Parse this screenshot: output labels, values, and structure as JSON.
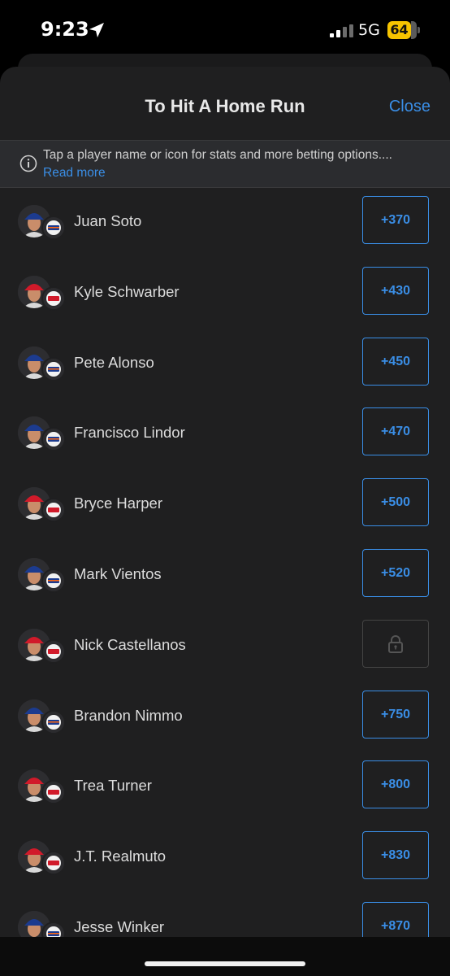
{
  "status_bar": {
    "time": "9:23",
    "network": "5G",
    "battery": "64",
    "icons": [
      "location-arrow-icon",
      "signal-icon",
      "battery-icon"
    ]
  },
  "sheet": {
    "title": "To Hit A Home Run",
    "close_label": "Close"
  },
  "banner": {
    "icon": "info-icon",
    "text": "Tap a player name or icon for stats and more betting options....",
    "link": "Read more"
  },
  "colors": {
    "accent": "#3a8ee6",
    "mets_blue": "#1c3b8f",
    "mets_orange": "#ff6a13",
    "phillies_red": "#d11a2a"
  },
  "players": [
    {
      "name": "Juan Soto",
      "odds": "+370",
      "team": "mets"
    },
    {
      "name": "Kyle Schwarber",
      "odds": "+430",
      "team": "phillies"
    },
    {
      "name": "Pete Alonso",
      "odds": "+450",
      "team": "mets"
    },
    {
      "name": "Francisco Lindor",
      "odds": "+470",
      "team": "mets"
    },
    {
      "name": "Bryce Harper",
      "odds": "+500",
      "team": "phillies"
    },
    {
      "name": "Mark Vientos",
      "odds": "+520",
      "team": "mets"
    },
    {
      "name": "Nick Castellanos",
      "odds": "",
      "team": "phillies",
      "locked": true
    },
    {
      "name": "Brandon Nimmo",
      "odds": "+750",
      "team": "mets"
    },
    {
      "name": "Trea Turner",
      "odds": "+800",
      "team": "phillies"
    },
    {
      "name": "J.T. Realmuto",
      "odds": "+830",
      "team": "phillies"
    },
    {
      "name": "Jesse Winker",
      "odds": "+870",
      "team": "mets"
    }
  ]
}
